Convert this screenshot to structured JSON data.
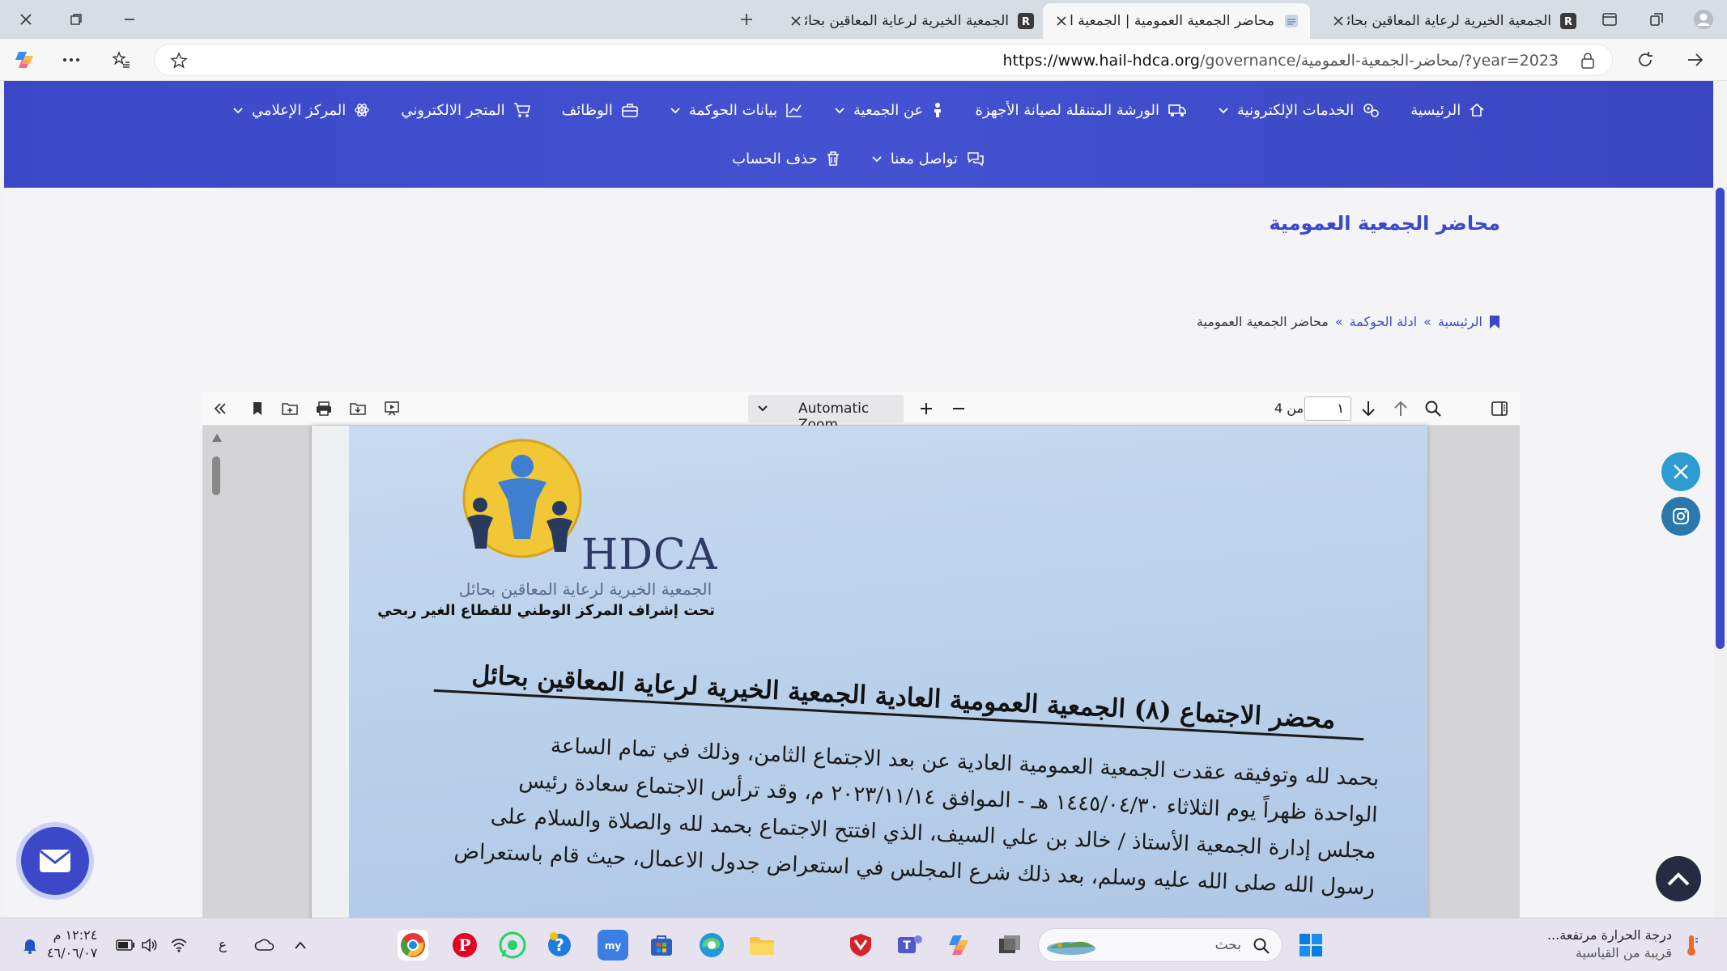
{
  "browser": {
    "tabs": [
      {
        "title": "الجمعية الخيرية لرعاية المعاقين بحائل",
        "active": false
      },
      {
        "title": "محاضر الجمعية العمومية | الجمعية الخيرية",
        "active": true
      },
      {
        "title": "الجمعية الخيرية لرعاية المعاقين بحائل",
        "active": false
      }
    ],
    "url_host": "https://www.hail-hdca.org",
    "url_path": "/governance/محاضر-الجمعية-العمومية/?year=2023"
  },
  "nav": {
    "row1": [
      {
        "label": "الرئيسية",
        "icon": "home-icon",
        "dropdown": false
      },
      {
        "label": "الخدمات الإلكترونية",
        "icon": "services-icon",
        "dropdown": true
      },
      {
        "label": "الورشة المتنقلة لصيانة الأجهزة",
        "icon": "truck-icon",
        "dropdown": false
      },
      {
        "label": "عن الجمعية",
        "icon": "person-icon",
        "dropdown": true
      },
      {
        "label": "بيانات الحوكمة",
        "icon": "chart-icon",
        "dropdown": true
      },
      {
        "label": "الوظائف",
        "icon": "briefcase-icon",
        "dropdown": false
      },
      {
        "label": "المتجر الالكتروني",
        "icon": "cart-icon",
        "dropdown": false
      },
      {
        "label": "المركز الإعلامي",
        "icon": "atom-icon",
        "dropdown": true
      }
    ],
    "row2": [
      {
        "label": "تواصل معنا",
        "icon": "chat-icon",
        "dropdown": true
      },
      {
        "label": "حذف الحساب",
        "icon": "trash-icon",
        "dropdown": false
      }
    ]
  },
  "page": {
    "title": "محاضر الجمعية العمومية",
    "breadcrumb": {
      "home": "الرئيسية",
      "sep": "»",
      "section": "ادلة الحوكمة",
      "current": "محاضر الجمعية العمومية"
    }
  },
  "pdf_viewer": {
    "zoom_label": "Automatic Zoom",
    "page_current": "١",
    "page_of": "من 4"
  },
  "document": {
    "logo_text": "HDCA",
    "logo_sub1": "الجمعية الخيرية لرعاية المعاقين بحائل",
    "logo_sub2": "تحت إشراف المركز الوطني للقطاع الغير ربحي",
    "heading": "محضر الاجتماع (٨) الجمعية العمومية العادية الجمعية الخيرية لرعاية المعاقين بحائل",
    "lines": [
      "بحمد لله وتوفيقه عقدت الجمعية العمومية العادية عن بعد الاجتماع الثامن، وذلك في تمام الساعة",
      "الواحدة ظهراً يوم الثلاثاء ١٤٤٥/٠٤/٣٠ هـ - الموافق ٢٠٢٣/١١/١٤ م، وقد ترأس الاجتماع سعادة رئيس",
      "مجلس إدارة الجمعية الأستاذ / خالد بن علي السيف، الذي افتتح الاجتماع بحمد لله والصلاة والسلام على",
      "رسول الله صلى الله عليه وسلم، بعد ذلك شرع المجلس في استعراض جدول الاعمال، حيث قام باستعراض"
    ]
  },
  "taskbar": {
    "search_placeholder": "بحث",
    "weather_title": "درجة الحرارة مرتفعة...",
    "weather_sub": "قريبة من القياسية",
    "time": "١٢:٢٤ م",
    "date": "٤٦/٠٦/٠٧",
    "lang": "ع"
  },
  "colors": {
    "brand": "#3b49c9",
    "twitter": "#2f9bd3",
    "instagram": "#2a78ac"
  }
}
